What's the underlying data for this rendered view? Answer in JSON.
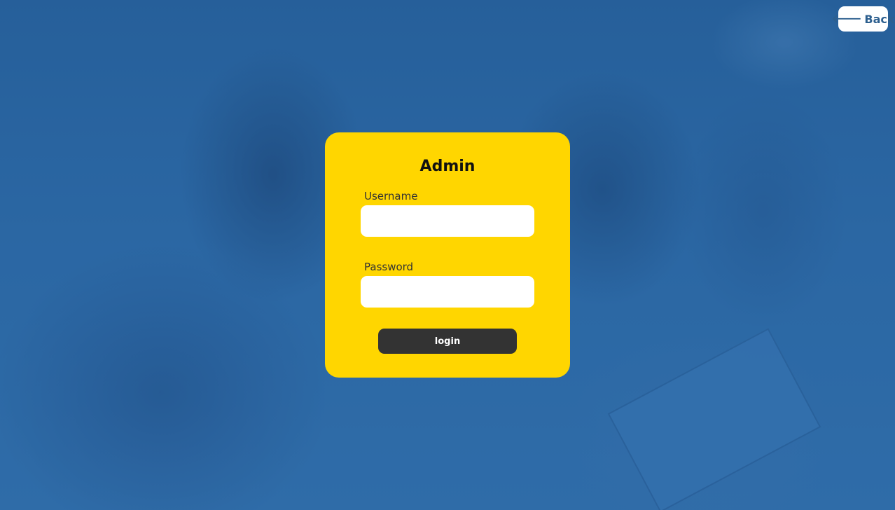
{
  "back_button": {
    "icon": "arrow-left-icon",
    "label": "Back"
  },
  "login_card": {
    "title": "Admin",
    "username_label": "Username",
    "username_value": "",
    "password_label": "Password",
    "password_value": "",
    "login_label": "login"
  },
  "colors": {
    "card_background": "#ffd600",
    "page_overlay": "#2d6aa6",
    "button_dark": "#333333",
    "back_text": "#2d5f8f"
  }
}
